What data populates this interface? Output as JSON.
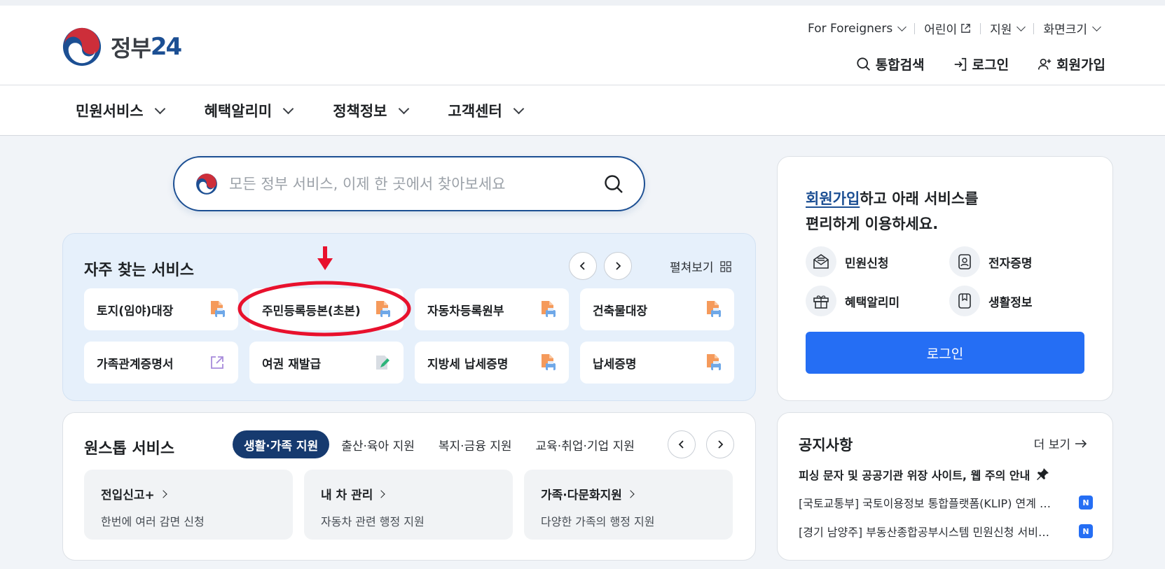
{
  "header": {
    "logo_text": "정부",
    "logo_num": "24",
    "util": {
      "foreigners": "For Foreigners",
      "kids": "어린이",
      "support": "지원",
      "screen_size": "화면크기"
    },
    "menu": {
      "search": "통합검색",
      "login": "로그인",
      "signup": "회원가입"
    }
  },
  "gnb": {
    "items": [
      "민원서비스",
      "혜택알리미",
      "정책정보",
      "고객센터"
    ]
  },
  "search": {
    "placeholder": "모든 정부 서비스, 이제 한 곳에서 찾아보세요"
  },
  "frequent": {
    "title": "자주 찾는 서비스",
    "expand_label": "펼쳐보기",
    "items": [
      {
        "label": "토지(임야)대장",
        "icon": "pdf-print-icon"
      },
      {
        "label": "주민등록등본(초본)",
        "icon": "pdf-print-icon"
      },
      {
        "label": "자동차등록원부",
        "icon": "pdf-print-icon"
      },
      {
        "label": "건축물대장",
        "icon": "pdf-print-icon"
      },
      {
        "label": "가족관계증명서",
        "icon": "external-link-icon"
      },
      {
        "label": "여권 재발급",
        "icon": "edit-document-icon"
      },
      {
        "label": "지방세 납세증명",
        "icon": "pdf-print-icon"
      },
      {
        "label": "납세증명",
        "icon": "pdf-print-icon"
      }
    ]
  },
  "onestop": {
    "title": "원스톱 서비스",
    "tabs": [
      "생활·가족 지원",
      "출산·육아 지원",
      "복지·금융 지원",
      "교육·취업·기업 지원"
    ],
    "active_tab": 0,
    "cards": [
      {
        "title": "전입신고+",
        "desc": "한번에 여러 감면 신청"
      },
      {
        "title": "내 차 관리",
        "desc": "자동차 관련 행정 지원"
      },
      {
        "title": "가족·다문화지원",
        "desc": "다양한 가족의 행정 지원"
      }
    ]
  },
  "login_panel": {
    "msg_link": "회원가입",
    "msg_rest": "하고 아래 서비스를",
    "msg_line2": "편리하게 이용하세요.",
    "items": [
      "민원신청",
      "전자증명",
      "혜택알리미",
      "생활정보"
    ],
    "login_button": "로그인"
  },
  "notice": {
    "title": "공지사항",
    "more": "더 보기",
    "pinned": "피싱 문자 및 공공기관 위장 사이트, 웹 주의 안내",
    "rows": [
      {
        "text": "[국토교통부] 국토이용정보 통합플랫폼(KLIP) 연계 서비스 안내",
        "badge": "N"
      },
      {
        "text": "[경기 남양주] 부동산종합공부시스템 민원신청 서비스 중단 안내",
        "badge": "N"
      }
    ]
  },
  "colors": {
    "primary": "#256ef4",
    "navy": "#163a6f",
    "annotation": "#e8112d",
    "freq_bg": "#e6f0fb"
  }
}
